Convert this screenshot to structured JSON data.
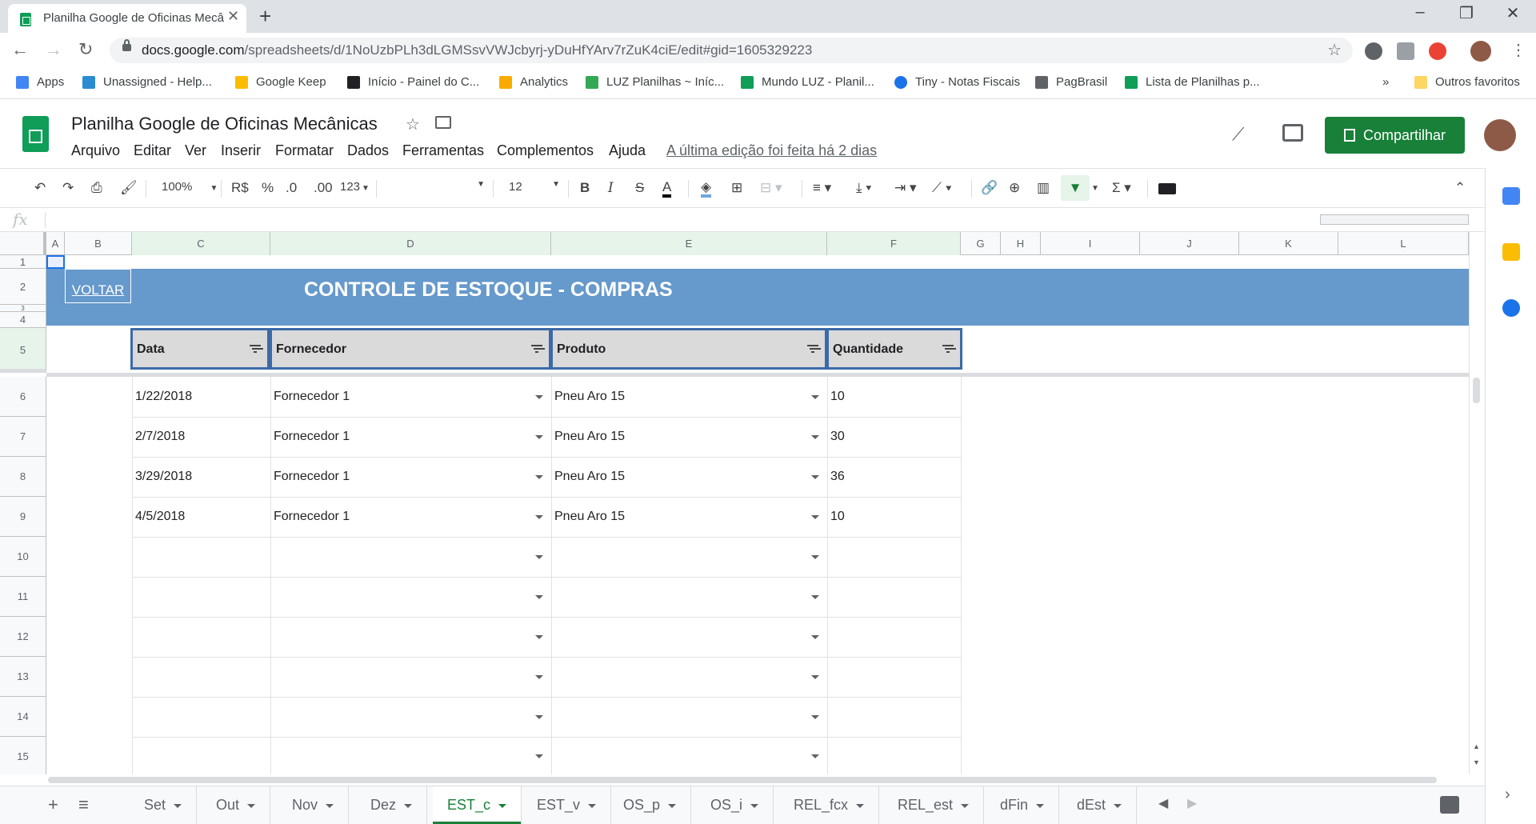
{
  "browser": {
    "tab_title": "Planilha Google de Oficinas Mecânicas - Google Planilhas",
    "url_host": "docs.google.com",
    "url_path": "/spreadsheets/d/1NoUzbPLh3dLGMSsvVWJcbyrj-yDuHfYArv7rZuK4ciE/edit#gid=1605329223",
    "window_controls": [
      "–",
      "❐",
      "✕"
    ],
    "bookmarks": [
      {
        "label": "Apps",
        "color": "#4285f4"
      },
      {
        "label": "Unassigned - Help...",
        "color": "#2a8cd3"
      },
      {
        "label": "Google Keep",
        "color": "#fbbc04"
      },
      {
        "label": "Início - Painel do C...",
        "color": "#202124"
      },
      {
        "label": "Analytics",
        "color": "#f9ab00"
      },
      {
        "label": "LUZ Planilhas ~ Iníc...",
        "color": "#34a853"
      },
      {
        "label": "Mundo LUZ - Planil...",
        "color": "#0f9d58"
      },
      {
        "label": "Tiny - Notas Fiscais",
        "color": "#1a73e8"
      },
      {
        "label": "PagBrasil",
        "color": "#5f6368"
      },
      {
        "label": "Lista de Planilhas p...",
        "color": "#0f9d58"
      }
    ],
    "bookmarks_more": "»",
    "other_bookmarks": "Outros favoritos"
  },
  "sheets_header": {
    "doc_title": "Planilha Google de Oficinas Mecânicas",
    "menus": [
      "Arquivo",
      "Editar",
      "Ver",
      "Inserir",
      "Formatar",
      "Dados",
      "Ferramentas",
      "Complementos",
      "Ajuda"
    ],
    "last_edit": "A última edição foi feita há 2 dias",
    "share_label": "Compartilhar"
  },
  "toolbar": {
    "zoom": "100%",
    "currency": "R$",
    "percent": "%",
    "dec_decrease": ".0",
    "dec_increase": ".00",
    "more_formats": "123",
    "font_name": "",
    "font_size": "12"
  },
  "formula_bar": {
    "fx": "fx",
    "value": ""
  },
  "columns": [
    "A",
    "B",
    "C",
    "D",
    "E",
    "F",
    "G",
    "H",
    "I",
    "J",
    "K",
    "L"
  ],
  "rows": [
    "1",
    "2",
    "3",
    "4",
    "5",
    "6",
    "7",
    "8",
    "9",
    "10",
    "11",
    "12",
    "13",
    "14",
    "15"
  ],
  "banner": {
    "back_link": "VOLTAR",
    "title": "CONTROLE DE ESTOQUE - COMPRAS",
    "color": "#6699cc"
  },
  "table": {
    "headers": [
      "Data",
      "Fornecedor",
      "Produto",
      "Quantidade"
    ],
    "rows": [
      {
        "data": "1/22/2018",
        "fornecedor": "Fornecedor 1",
        "produto": "Pneu Aro 15",
        "quantidade": "10"
      },
      {
        "data": "2/7/2018",
        "fornecedor": "Fornecedor 1",
        "produto": "Pneu Aro 15",
        "quantidade": "30"
      },
      {
        "data": "3/29/2018",
        "fornecedor": "Fornecedor 1",
        "produto": "Pneu Aro 15",
        "quantidade": "36"
      },
      {
        "data": "4/5/2018",
        "fornecedor": "Fornecedor 1",
        "produto": "Pneu Aro 15",
        "quantidade": "10"
      },
      {
        "data": "",
        "fornecedor": "",
        "produto": "",
        "quantidade": ""
      },
      {
        "data": "",
        "fornecedor": "",
        "produto": "",
        "quantidade": ""
      },
      {
        "data": "",
        "fornecedor": "",
        "produto": "",
        "quantidade": ""
      },
      {
        "data": "",
        "fornecedor": "",
        "produto": "",
        "quantidade": ""
      },
      {
        "data": "",
        "fornecedor": "",
        "produto": "",
        "quantidade": ""
      },
      {
        "data": "",
        "fornecedor": "",
        "produto": "",
        "quantidade": ""
      }
    ]
  },
  "sheet_tabs": [
    {
      "label": "Set",
      "active": false
    },
    {
      "label": "Out",
      "active": false
    },
    {
      "label": "Nov",
      "active": false
    },
    {
      "label": "Dez",
      "active": false
    },
    {
      "label": "EST_c",
      "active": true
    },
    {
      "label": "EST_v",
      "active": false
    },
    {
      "label": "OS_p",
      "active": false
    },
    {
      "label": "OS_i",
      "active": false
    },
    {
      "label": "REL_fcx",
      "active": false
    },
    {
      "label": "REL_est",
      "active": false
    },
    {
      "label": "dFin",
      "active": false
    },
    {
      "label": "dEst",
      "active": false
    }
  ],
  "colors": {
    "header_border": "#3c6aa8",
    "share_button": "#188038",
    "active_tab": "#188038"
  }
}
